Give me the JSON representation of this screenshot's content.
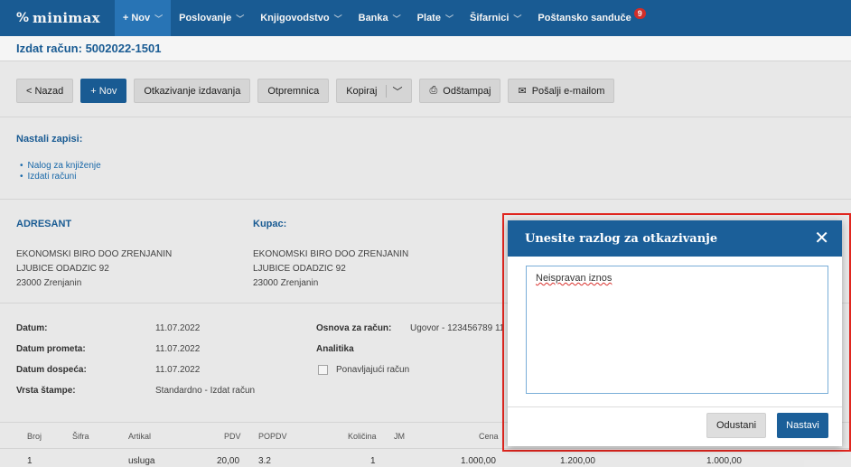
{
  "nav": {
    "logo_mark": "%",
    "logo_text": "minimax",
    "items": [
      {
        "label": "+ Nov",
        "chevron": "﹀"
      },
      {
        "label": "Poslovanje",
        "chevron": "﹀"
      },
      {
        "label": "Knjigovodstvo",
        "chevron": "﹀"
      },
      {
        "label": "Banka",
        "chevron": "﹀"
      },
      {
        "label": "Plate",
        "chevron": "﹀"
      },
      {
        "label": "Šifarnici",
        "chevron": "﹀"
      },
      {
        "label": "Poštansko sanduče",
        "badge": "9"
      }
    ]
  },
  "page_title": "Izdat račun: 5002022-1501",
  "toolbar": {
    "back": "< Nazad",
    "new": "+ Nov",
    "cancel_issue": "Otkazivanje izdavanja",
    "dispatch": "Otpremnica",
    "copy": "Kopiraj",
    "copy_chevron": "﹀",
    "print": "Odštampaj",
    "print_icon": "⎙",
    "email": "Pošalji e-mailom",
    "email_icon": "✉"
  },
  "records": {
    "title": "Nastali zapisi:",
    "items": [
      "Nalog za knjiženje",
      "Izdati računi"
    ]
  },
  "sender": {
    "title": "ADRESANT",
    "name": "EKONOMSKI BIRO DOO ZRENJANIN",
    "street": "LJUBICE ODADZIC 92",
    "city": "23000 Zrenjanin"
  },
  "buyer": {
    "title": "Kupac:",
    "name": "EKONOMSKI BIRO DOO ZRENJANIN",
    "street": "LJUBICE ODADZIC 92",
    "city": "23000 Zrenjanin"
  },
  "details": {
    "date_label": "Datum:",
    "date": "11.07.2022",
    "transaction_label": "Datum prometa:",
    "transaction": "11.07.2022",
    "due_label": "Datum dospeća:",
    "due": "11.07.2022",
    "print_type_label": "Vrsta štampe:",
    "print_type": "Standardno - Izdat račun",
    "basis_label": "Osnova za račun:",
    "basis": "Ugovor - 123456789 11",
    "analytics_label": "Analitika",
    "recurring_label": "Ponavljajući račun"
  },
  "table": {
    "headers": [
      "Broj",
      "Šifra",
      "Artikal",
      "PDV",
      "POPDV",
      "Količina",
      "JM",
      "Cena"
    ],
    "row": [
      "1",
      "",
      "usluga",
      "20,00",
      "3.2",
      "1",
      "",
      "1.000,00",
      "1.200,00",
      "1.000,00"
    ]
  },
  "modal": {
    "title": "Unesite razlog za otkazivanje",
    "close": "✕",
    "reason": "Neispravan iznos",
    "cancel": "Odustani",
    "ok": "Nastavi"
  }
}
